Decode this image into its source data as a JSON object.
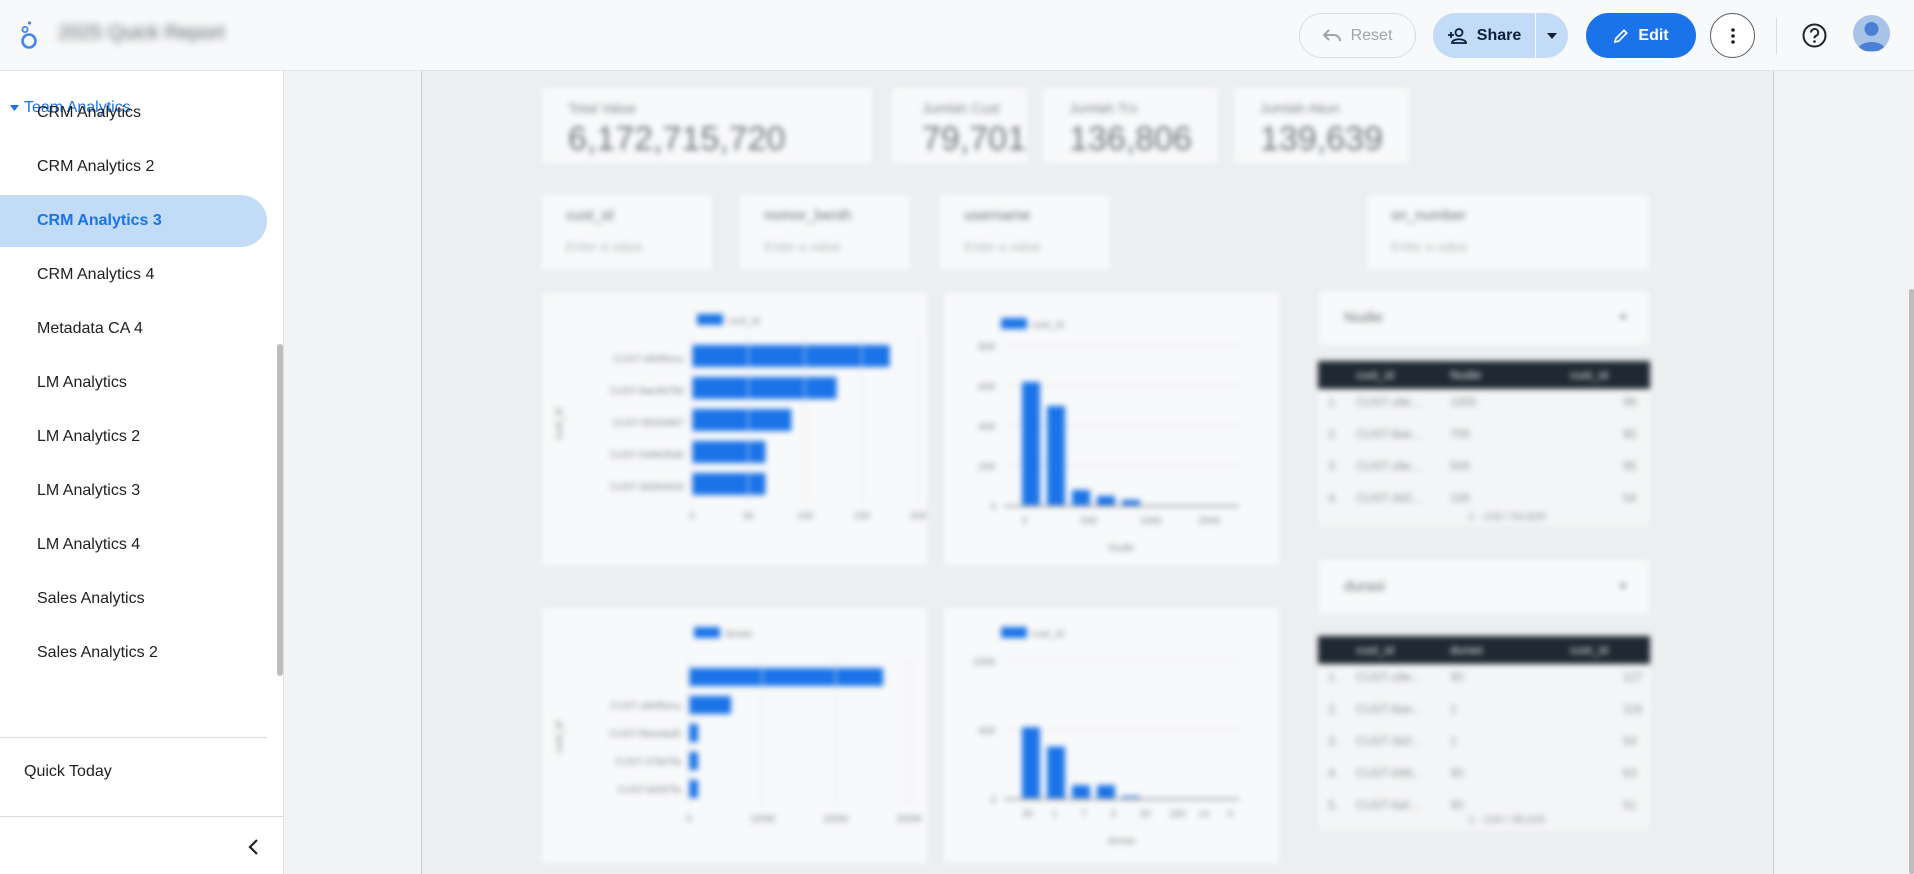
{
  "header": {
    "report_title": "2025 Quick Report",
    "reset_label": "Reset",
    "share_label": "Share",
    "edit_label": "Edit"
  },
  "sidebar": {
    "section_label": "Team Analytics",
    "items": [
      {
        "label": "CRM Analytics"
      },
      {
        "label": "CRM Analytics 2"
      },
      {
        "label": "CRM Analytics 3",
        "active": true
      },
      {
        "label": "CRM Analytics 4"
      },
      {
        "label": "Metadata CA 4"
      },
      {
        "label": "LM Analytics"
      },
      {
        "label": "LM Analytics 2"
      },
      {
        "label": "LM Analytics 3"
      },
      {
        "label": "LM Analytics 4"
      },
      {
        "label": "Sales Analytics"
      },
      {
        "label": "Sales Analytics 2"
      }
    ],
    "quick_today_label": "Quick Today"
  },
  "report": {
    "kpis": [
      {
        "label": "Total Value",
        "value": "6,172,715,720"
      },
      {
        "label": "Jumlah Cust",
        "value": "79,701"
      },
      {
        "label": "Jumlah Trx",
        "value": "136,806"
      },
      {
        "label": "Jumlah Akun",
        "value": "139,639"
      }
    ],
    "filters": [
      {
        "label": "cust_id",
        "placeholder": "Enter a value"
      },
      {
        "label": "nomor_benih",
        "placeholder": "Enter a value"
      },
      {
        "label": "username",
        "placeholder": "Enter a value"
      },
      {
        "label": "sn_number",
        "placeholder": "Enter a value"
      }
    ],
    "dropdowns": [
      "Nudie",
      "durasi"
    ],
    "table1": {
      "headers": [
        "cust_id",
        "Nudie",
        "cust_id"
      ],
      "rows": [
        [
          "1.",
          "CUST-z8e...",
          "1000",
          "99"
        ],
        [
          "2.",
          "CUST-8ae...",
          "700",
          "85"
        ],
        [
          "3.",
          "CUST-z8e...",
          "500",
          "95"
        ],
        [
          "4.",
          "CUST-3d2...",
          "100",
          "54"
        ]
      ],
      "pagination": "1 - 100 / 54,629"
    },
    "table2": {
      "headers": [
        "cust_id",
        "durasi",
        "cust_id"
      ],
      "rows": [
        [
          "1.",
          "CUST-z8e...",
          "30",
          "127"
        ],
        [
          "2.",
          "CUST-8ae...",
          "1",
          "116"
        ],
        [
          "3.",
          "CUST-3d2...",
          "1",
          "54"
        ],
        [
          "4.",
          "CUST-049...",
          "30",
          "63"
        ],
        [
          "5.",
          "CUST-5af...",
          "30",
          "51"
        ]
      ],
      "pagination": "1 - 100 / 38,025"
    },
    "charts": [
      {
        "legend": "cust_id",
        "ylabel": "cust_id",
        "xticks": [
          "0",
          "50",
          "100",
          "150",
          "200"
        ],
        "categories": [
          "CUST-z8ef5ecu",
          "CUST-8ae367b0",
          "CUST-9f183967",
          "CUST-049635d0",
          "CUST-3d284d15"
        ],
        "values": [
          175,
          128,
          88,
          65,
          65
        ]
      },
      {
        "legend": "cust_id",
        "xlabel": "Nudie",
        "yticks": [
          "0",
          "20K",
          "40K",
          "60K",
          "80K"
        ],
        "xticks": [
          "0",
          "500",
          "1000",
          "2000"
        ],
        "values": [
          62000,
          50000,
          8000,
          5000,
          3000
        ]
      },
      {
        "legend": "durasi",
        "ylabel": "cust_id",
        "xticks": [
          "0",
          "100M",
          "200M",
          "300M"
        ],
        "categories": [
          "",
          "CUST-z8ef5ecu",
          "CUST-f9eeda45",
          "CUST-275d7fa",
          "CUST-b05f7fa"
        ],
        "values": [
          300,
          65,
          14,
          14,
          14
        ]
      },
      {
        "legend": "cust_id",
        "xlabel": "durasi",
        "yticks": [
          "0",
          "50K",
          "100K"
        ],
        "xticks": [
          "30",
          "1",
          "7",
          "3",
          "20",
          "180",
          "14",
          "0"
        ],
        "values": [
          52000,
          38000,
          10000,
          10000,
          2000
        ]
      }
    ]
  }
}
